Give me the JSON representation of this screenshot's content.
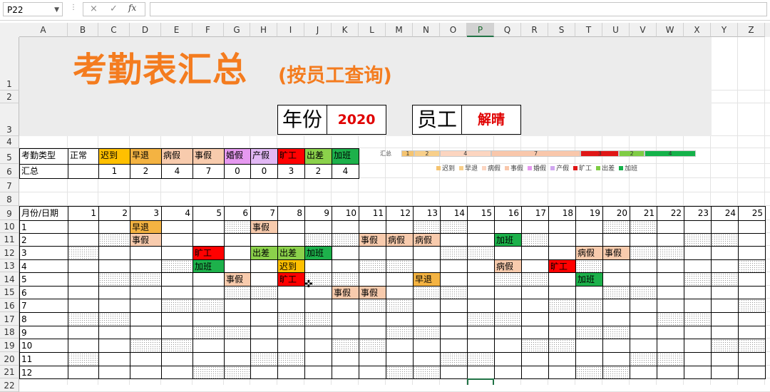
{
  "formula_bar": {
    "name_box": "P22",
    "cancel_icon": "×",
    "enter_icon": "✓",
    "fx": "fx",
    "formula": ""
  },
  "selected_column": "P",
  "columns": [
    "A",
    "B",
    "C",
    "D",
    "E",
    "F",
    "G",
    "H",
    "I",
    "J",
    "K",
    "L",
    "M",
    "N",
    "O",
    "P",
    "Q",
    "R",
    "S",
    "T",
    "U",
    "V",
    "W",
    "X",
    "Y",
    "Z"
  ],
  "rows": [
    "1",
    "2",
    "3",
    "4",
    "5",
    "6",
    "7",
    "8",
    "9",
    "10",
    "11",
    "12",
    "13",
    "14",
    "15",
    "16",
    "17",
    "18",
    "19",
    "20",
    "21",
    "22"
  ],
  "title": "考勤表汇总",
  "subtitle": "(按员工查询)",
  "year_box": {
    "label": "年份",
    "value": "2020"
  },
  "employee_box": {
    "label": "员工",
    "value": "解晴"
  },
  "summary": {
    "header_label": "考勤类型",
    "total_label": "汇总",
    "types": [
      "正常",
      "迟到",
      "早退",
      "病假",
      "事假",
      "婚假",
      "产假",
      "旷工",
      "出差",
      "加班"
    ],
    "colors": [
      "#ffffff",
      "#ffc000",
      "#f4b342",
      "#f8cbad",
      "#f8cbad",
      "#e699f0",
      "#e2b8f5",
      "#ff0000",
      "#8bd14b",
      "#1db14b"
    ],
    "counts": [
      "",
      "1",
      "2",
      "4",
      "7",
      "0",
      "0",
      "3",
      "2",
      "4"
    ]
  },
  "mini_chart": {
    "label": "汇总",
    "segments": [
      {
        "type": "迟到",
        "value": 1,
        "color": "#f5c470"
      },
      {
        "type": "早退",
        "value": 2,
        "color": "#f8cf8a"
      },
      {
        "type": "病假",
        "value": 4,
        "color": "#fcd5c0"
      },
      {
        "type": "事假",
        "value": 7,
        "color": "#f9c7ab"
      },
      {
        "type": "婚假",
        "value": 0,
        "color": "#e699f0"
      },
      {
        "type": "产假",
        "value": 0,
        "color": "#d0a6f0"
      },
      {
        "type": "旷工",
        "value": 3,
        "color": "#e01616"
      },
      {
        "type": "出差",
        "value": 2,
        "color": "#7fcc44"
      },
      {
        "type": "加班",
        "value": 4,
        "color": "#14b24a"
      }
    ]
  },
  "calendar": {
    "header": "月份/日期",
    "months": [
      "1",
      "2",
      "3",
      "4",
      "5",
      "6",
      "7",
      "8",
      "9",
      "10",
      "11",
      "12"
    ],
    "days": [
      "1",
      "2",
      "3",
      "4",
      "5",
      "6",
      "7",
      "8",
      "9",
      "10",
      "11",
      "12",
      "13",
      "14",
      "15",
      "16",
      "17",
      "18",
      "19",
      "20",
      "21",
      "22",
      "23",
      "24",
      "25"
    ],
    "entries": [
      {
        "m": 0,
        "d": 2,
        "t": "早退"
      },
      {
        "m": 0,
        "d": 6,
        "t": "事假"
      },
      {
        "m": 1,
        "d": 2,
        "t": "事假"
      },
      {
        "m": 1,
        "d": 10,
        "t": "事假"
      },
      {
        "m": 1,
        "d": 11,
        "t": "病假"
      },
      {
        "m": 1,
        "d": 12,
        "t": "病假"
      },
      {
        "m": 1,
        "d": 15,
        "t": "加班"
      },
      {
        "m": 2,
        "d": 4,
        "t": "旷工"
      },
      {
        "m": 2,
        "d": 6,
        "t": "出差"
      },
      {
        "m": 2,
        "d": 7,
        "t": "出差"
      },
      {
        "m": 2,
        "d": 8,
        "t": "加班"
      },
      {
        "m": 2,
        "d": 18,
        "t": "病假"
      },
      {
        "m": 2,
        "d": 19,
        "t": "事假"
      },
      {
        "m": 3,
        "d": 4,
        "t": "加班"
      },
      {
        "m": 3,
        "d": 7,
        "t": "迟到"
      },
      {
        "m": 3,
        "d": 15,
        "t": "病假"
      },
      {
        "m": 3,
        "d": 17,
        "t": "旷工"
      },
      {
        "m": 4,
        "d": 5,
        "t": "事假"
      },
      {
        "m": 4,
        "d": 7,
        "t": "旷工"
      },
      {
        "m": 4,
        "d": 12,
        "t": "早退"
      },
      {
        "m": 4,
        "d": 18,
        "t": "加班"
      },
      {
        "m": 5,
        "d": 9,
        "t": "事假"
      },
      {
        "m": 5,
        "d": 10,
        "t": "事假"
      }
    ],
    "weekends": [
      [
        5,
        6,
        12,
        13,
        19,
        20
      ],
      [
        1,
        2,
        8,
        9,
        15,
        16,
        22,
        23
      ],
      [
        0,
        6,
        7,
        13,
        14,
        20,
        21
      ],
      [
        3,
        4,
        10,
        11,
        17,
        18,
        24
      ],
      [
        1,
        2,
        8,
        9,
        15,
        16,
        22,
        23
      ],
      [
        5,
        6,
        12,
        13,
        19,
        20
      ],
      [
        3,
        4,
        10,
        11,
        17,
        18,
        24
      ],
      [
        0,
        1,
        7,
        8,
        14,
        15,
        21,
        22
      ],
      [
        4,
        5,
        11,
        12,
        18,
        19
      ],
      [
        2,
        3,
        9,
        10,
        16,
        17,
        23,
        24
      ],
      [
        0,
        6,
        7,
        13,
        14,
        20,
        21
      ],
      [
        4,
        5,
        11,
        12,
        18,
        19
      ]
    ]
  }
}
